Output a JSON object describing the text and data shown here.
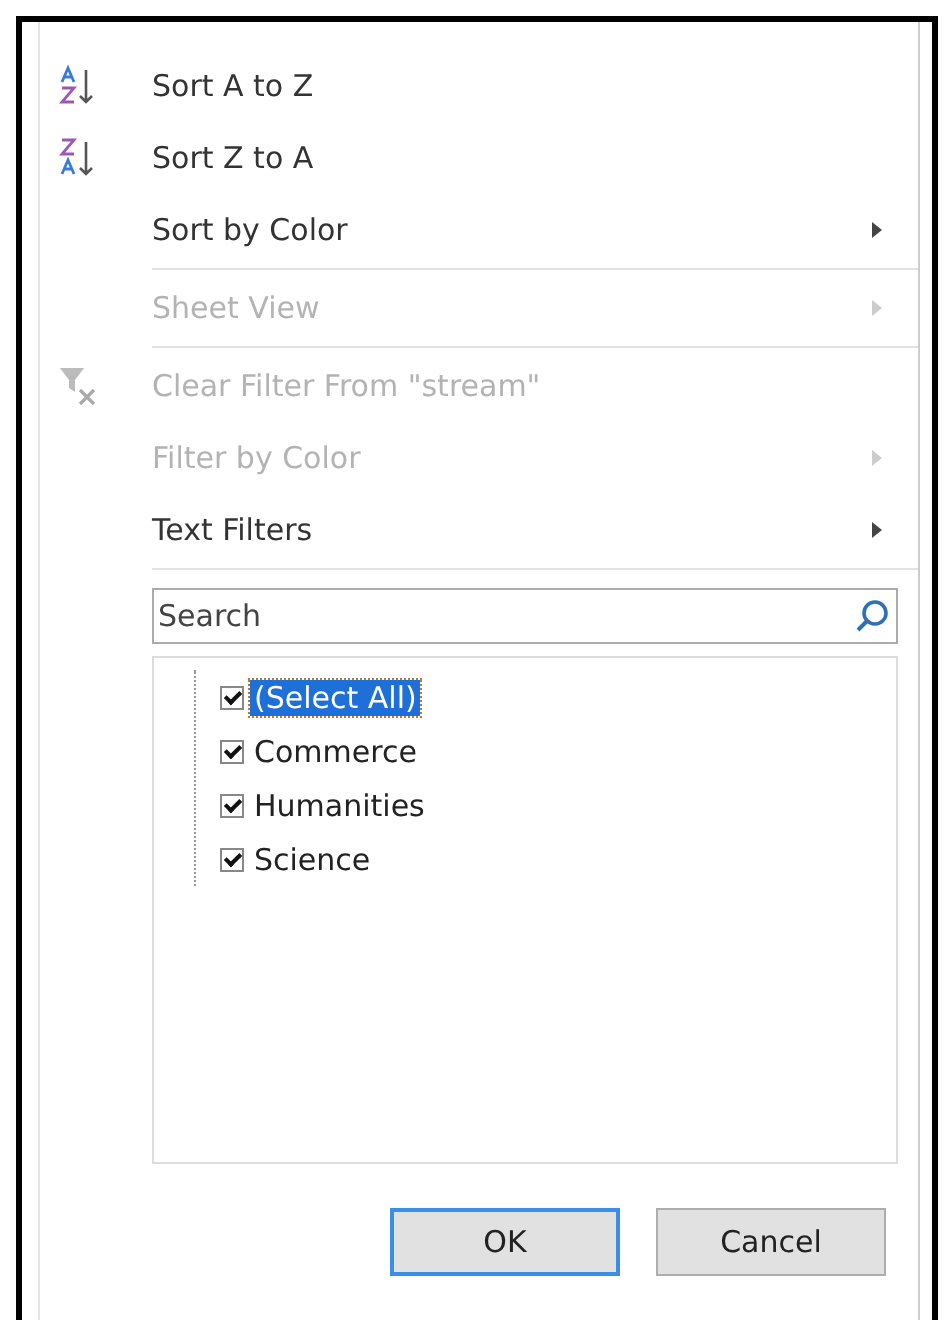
{
  "menu": [
    {
      "kind": "sort_ascending",
      "label": "Sort A to Z",
      "disabled": false,
      "submenu": false
    },
    {
      "kind": "sort_descending",
      "label": "Sort Z to A",
      "disabled": false,
      "submenu": false
    },
    {
      "kind": "item",
      "label": "Sort by Color",
      "disabled": false,
      "submenu": true
    },
    {
      "kind": "separator"
    },
    {
      "kind": "item",
      "label": "Sheet View",
      "disabled": true,
      "submenu": true
    },
    {
      "kind": "separator"
    },
    {
      "kind": "clear_filter",
      "label": "Clear Filter From \"stream\"",
      "disabled": true,
      "submenu": false
    },
    {
      "kind": "item",
      "label": "Filter by Color",
      "disabled": true,
      "submenu": true
    },
    {
      "kind": "item",
      "label": "Text Filters",
      "disabled": false,
      "submenu": true
    },
    {
      "kind": "separator"
    }
  ],
  "search": {
    "placeholder": "Search"
  },
  "values": [
    {
      "label": "(Select All)",
      "checked": true,
      "selected": true
    },
    {
      "label": "Commerce",
      "checked": true,
      "selected": false
    },
    {
      "label": "Humanities",
      "checked": true,
      "selected": false
    },
    {
      "label": "Science",
      "checked": true,
      "selected": false
    }
  ],
  "buttons": [
    {
      "label": "OK",
      "default": true
    },
    {
      "label": "Cancel",
      "default": false
    }
  ]
}
